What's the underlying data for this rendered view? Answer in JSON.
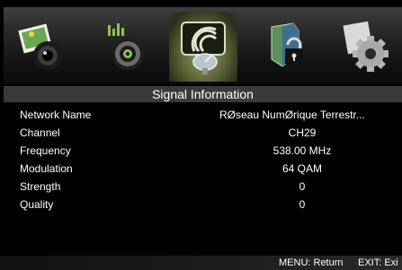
{
  "menu": {
    "icons": [
      "picture-icon",
      "sound-icon",
      "channel-icon",
      "lock-icon",
      "setup-icon"
    ],
    "selected": "channel-icon"
  },
  "title": "Signal Information",
  "info": {
    "network_name": {
      "label": "Network Name",
      "value": "RØseau NumØrique Terrestr..."
    },
    "channel": {
      "label": "Channel",
      "value": "CH29"
    },
    "frequency": {
      "label": "Frequency",
      "value": "538.00 MHz"
    },
    "modulation": {
      "label": "Modulation",
      "value": "64 QAM"
    },
    "strength": {
      "label": "Strength",
      "value": "0"
    },
    "quality": {
      "label": "Quality",
      "value": "0"
    }
  },
  "footer": {
    "menu_hint": "MENU: Return",
    "exit_hint": "EXIT: Exi"
  },
  "colors": {
    "background": "#000000",
    "title_bar": "#3a3a3a",
    "selected_glow": "#8f9660",
    "text": "#ffffff"
  }
}
